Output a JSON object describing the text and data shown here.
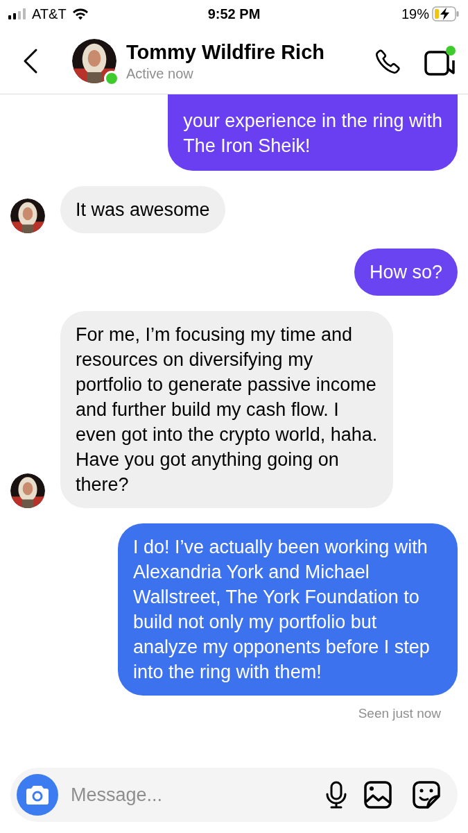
{
  "status_bar": {
    "carrier": "AT&T",
    "time": "9:52 PM",
    "battery": "19%",
    "charging": true
  },
  "header": {
    "name": "Tommy Wildfire Rich",
    "status": "Active now",
    "online": true
  },
  "messages": [
    {
      "kind": "outgoing",
      "text": "your experience in the ring with\nThe Iron Sheik!",
      "color": "#6a3ff2"
    },
    {
      "kind": "incoming",
      "text": "It was awesome"
    },
    {
      "kind": "outgoing",
      "text": "How so?",
      "color": "#6a44f0"
    },
    {
      "kind": "incoming",
      "text": "For me, I’m focusing my time and resources on diversifying my portfolio to generate passive income and further build my cash flow. I even got into the crypto world, haha.\nHave you got anything going on there?"
    },
    {
      "kind": "outgoing",
      "text": "I do! I’ve actually been working with Alexandria York and Michael Wallstreet, The York Foundation to build not only my portfolio but analyze my opponents before I step into the ring with them!",
      "color": "#3d72ef"
    }
  ],
  "seen": "Seen just now",
  "composer": {
    "placeholder": "Message..."
  }
}
